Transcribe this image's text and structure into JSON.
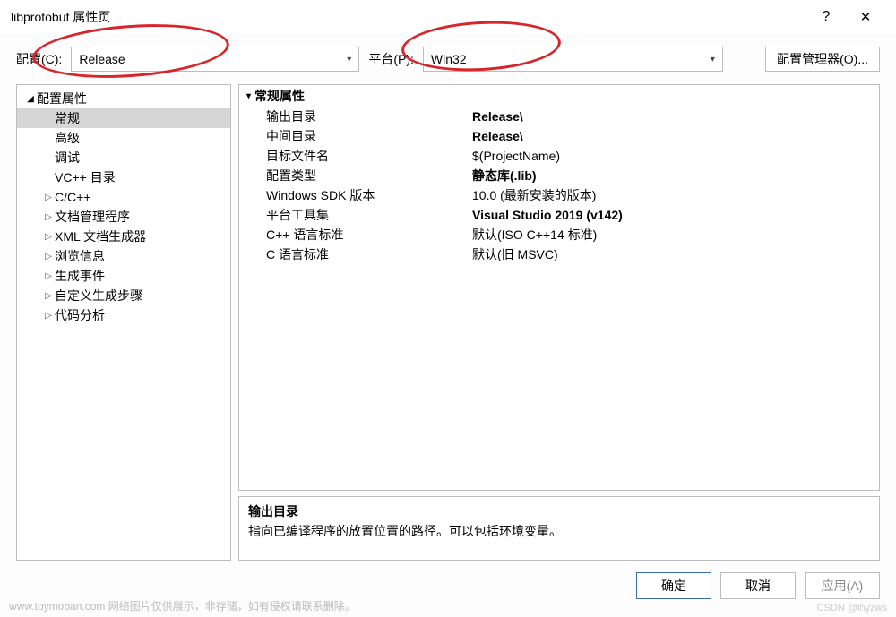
{
  "window": {
    "title": "libprotobuf 属性页",
    "help_glyph": "?",
    "close_glyph": "✕"
  },
  "toolbar": {
    "config_label": "配置(C):",
    "config_value": "Release",
    "platform_label": "平台(P):",
    "platform_value": "Win32",
    "config_mgr_label": "配置管理器(O)..."
  },
  "tree": [
    {
      "label": "配置属性",
      "level": 0,
      "arrow": "down",
      "selected": false
    },
    {
      "label": "常规",
      "level": 1,
      "arrow": "",
      "selected": true
    },
    {
      "label": "高级",
      "level": 1,
      "arrow": "",
      "selected": false
    },
    {
      "label": "调试",
      "level": 1,
      "arrow": "",
      "selected": false
    },
    {
      "label": "VC++ 目录",
      "level": 1,
      "arrow": "",
      "selected": false
    },
    {
      "label": "C/C++",
      "level": 1,
      "arrow": "right",
      "selected": false
    },
    {
      "label": "文档管理程序",
      "level": 1,
      "arrow": "right",
      "selected": false
    },
    {
      "label": "XML 文档生成器",
      "level": 1,
      "arrow": "right",
      "selected": false
    },
    {
      "label": "浏览信息",
      "level": 1,
      "arrow": "right",
      "selected": false
    },
    {
      "label": "生成事件",
      "level": 1,
      "arrow": "right",
      "selected": false
    },
    {
      "label": "自定义生成步骤",
      "level": 1,
      "arrow": "right",
      "selected": false
    },
    {
      "label": "代码分析",
      "level": 1,
      "arrow": "right",
      "selected": false
    }
  ],
  "section_title": "常规属性",
  "properties": [
    {
      "name": "输出目录",
      "value": "Release\\",
      "bold": true
    },
    {
      "name": "中间目录",
      "value": "Release\\",
      "bold": true
    },
    {
      "name": "目标文件名",
      "value": "$(ProjectName)",
      "bold": false
    },
    {
      "name": "配置类型",
      "value": "静态库(.lib)",
      "bold": true
    },
    {
      "name": "Windows SDK 版本",
      "value": "10.0 (最新安装的版本)",
      "bold": false
    },
    {
      "name": "平台工具集",
      "value": "Visual Studio 2019 (v142)",
      "bold": true
    },
    {
      "name": "C++ 语言标准",
      "value": "默认(ISO C++14 标准)",
      "bold": false
    },
    {
      "name": "C 语言标准",
      "value": "默认(旧 MSVC)",
      "bold": false
    }
  ],
  "description": {
    "title": "输出目录",
    "body": "指向已编译程序的放置位置的路径。可以包括环境变量。"
  },
  "footer": {
    "ok": "确定",
    "cancel": "取消",
    "apply": "应用(A)"
  },
  "watermark": {
    "left": "www.toymoban.com 网络图片仅供展示，非存储，如有侵权请联系删除。",
    "right": "CSDN @lhyzws"
  }
}
